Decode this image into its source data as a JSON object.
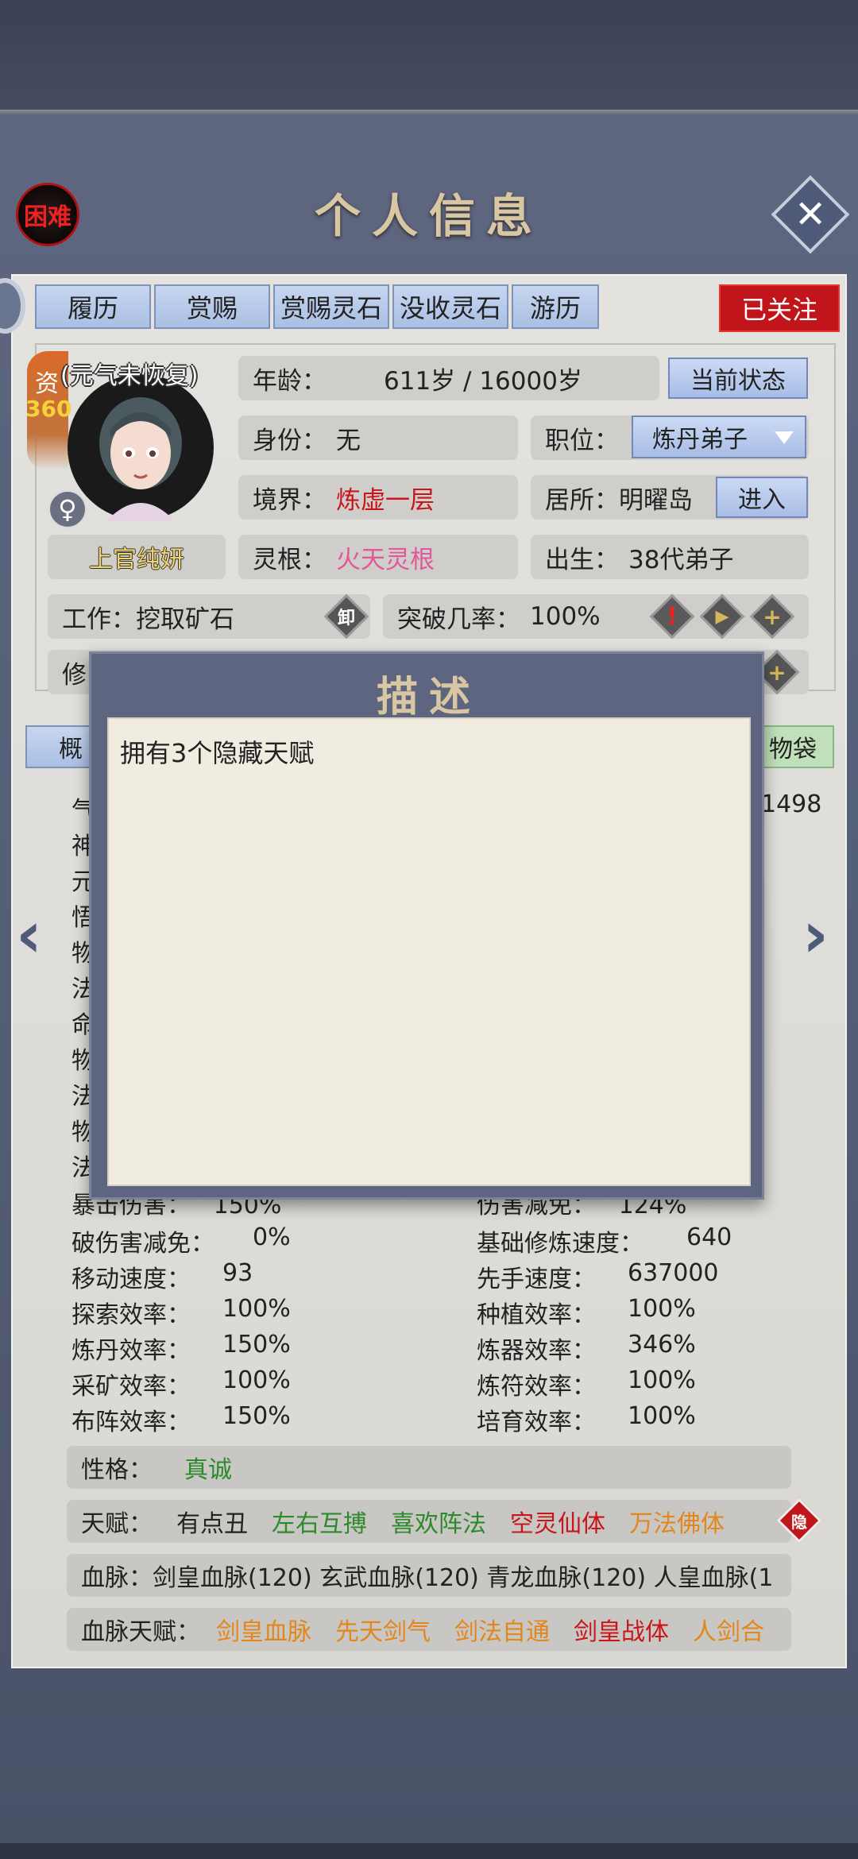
{
  "header": {
    "difficulty": "困难",
    "title": "个人信息",
    "close": "✕"
  },
  "tabs": [
    "履历",
    "赏赐",
    "赏赐灵石",
    "没收灵石",
    "游历"
  ],
  "follow_button": "已关注",
  "character": {
    "aptitude_label": "资",
    "aptitude_value": "360",
    "status_note": "(元气未恢复)",
    "gender_symbol": "♀",
    "name": "上官纯妍",
    "age_label": "年龄：",
    "age_value": "611岁 / 16000岁",
    "current_state_button": "当前状态",
    "identity_label": "身份：",
    "identity_value": "无",
    "position_label": "职位：",
    "position_value": "炼丹弟子",
    "realm_label": "境界：",
    "realm_value": "炼虚一层",
    "residence_label": "居所：",
    "residence_value": "明曜岛",
    "enter_button": "进入",
    "root_label": "灵根：",
    "root_value": "火天灵根",
    "birth_label": "出生：",
    "birth_value": "38代弟子",
    "work_label": "工作：",
    "work_value": "挖取矿石",
    "unload_icon_text": "卸",
    "breakthrough_label": "突破几率：",
    "breakthrough_value": "100%",
    "cultivation_partial": "修"
  },
  "lower_tabs": {
    "overview_partial": "概",
    "bag_partial": "物袋"
  },
  "hidden_stat_partials": {
    "left_chars": [
      "气",
      "神",
      "元",
      "悟",
      "物",
      "法",
      "命",
      "物",
      "法",
      "物",
      "法"
    ],
    "right_value": "1498",
    "crit_damage_partial": "暴击伤害：   150%",
    "damage_reduction_partial": "伤害减免：   124%"
  },
  "stats_left": [
    {
      "label": "破伤害减免：",
      "value": "0%"
    },
    {
      "label": "移动速度：",
      "value": "93"
    },
    {
      "label": "探索效率：",
      "value": "100%"
    },
    {
      "label": "炼丹效率：",
      "value": "150%"
    },
    {
      "label": "采矿效率：",
      "value": "100%"
    },
    {
      "label": "布阵效率：",
      "value": "150%"
    }
  ],
  "stats_right": [
    {
      "label": "基础修炼速度：",
      "value": "640"
    },
    {
      "label": "先手速度：",
      "value": "637000"
    },
    {
      "label": "种植效率：",
      "value": "100%"
    },
    {
      "label": "炼器效率：",
      "value": "346%"
    },
    {
      "label": "炼符效率：",
      "value": "100%"
    },
    {
      "label": "培育效率：",
      "value": "100%"
    }
  ],
  "personality": {
    "label": "性格：",
    "value": "真诚"
  },
  "talents": {
    "label": "天赋：",
    "items": [
      "有点丑",
      "左右互搏",
      "喜欢阵法",
      "空灵仙体",
      "万法佛体"
    ],
    "hide_icon_text": "隐"
  },
  "bloodline": {
    "label": "血脉：",
    "value": "剑皇血脉(120) 玄武血脉(120) 青龙血脉(120) 人皇血脉(1"
  },
  "bloodline_talents": {
    "label": "血脉天赋：",
    "items": [
      "剑皇血脉",
      "先天剑气",
      "剑法自通",
      "剑皇战体",
      "人剑合"
    ]
  },
  "popup": {
    "title": "描述",
    "text": "拥有3个隐藏天赋"
  },
  "colors": {
    "red": "#c8161b",
    "pink": "#e0579a",
    "green": "#2d8a2a",
    "orange": "#e3861b"
  }
}
